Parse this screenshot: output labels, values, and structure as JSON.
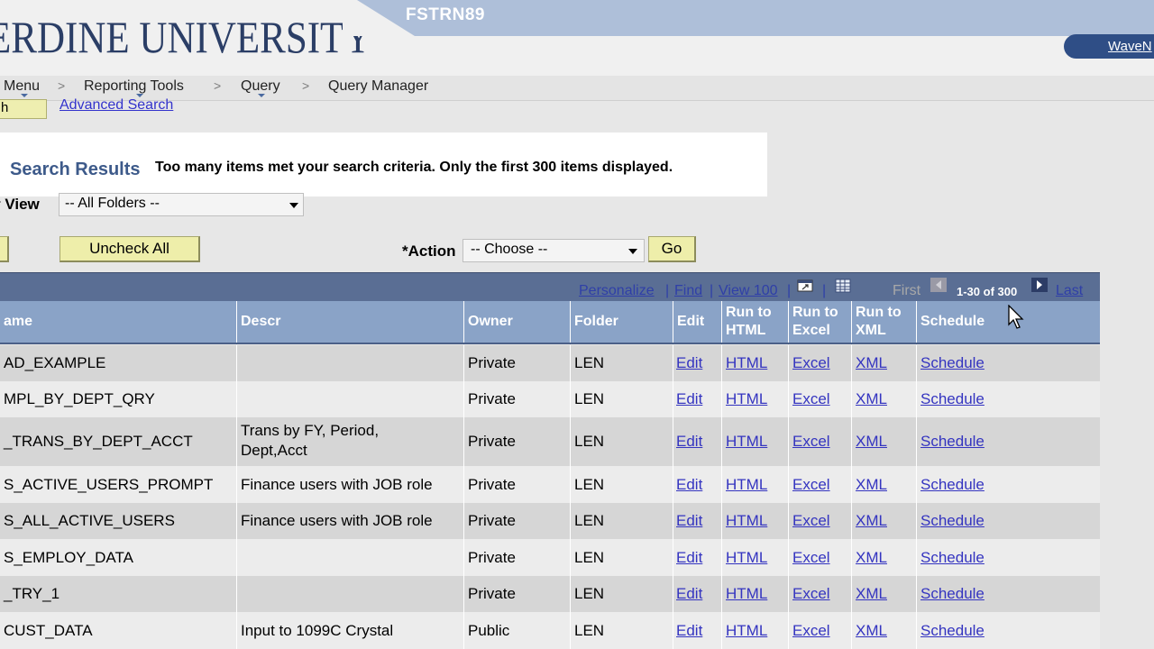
{
  "header": {
    "logo_text": "ERDINE UNIVERSITY",
    "database": "FSTRN89",
    "right_link": "WaveN"
  },
  "breadcrumb": {
    "items": [
      "Menu",
      "Reporting Tools",
      "Query",
      "Query Manager"
    ],
    "separator": ">"
  },
  "search": {
    "button_label": "h",
    "advanced_link": "Advanced Search"
  },
  "results": {
    "title": "Search Results",
    "message": "Too many items met your search criteria. Only the first 300 items displayed."
  },
  "folder_view": {
    "label": "r View",
    "selected": "-- All Folders --"
  },
  "actions": {
    "uncheck_all": "Uncheck All",
    "action_label": "*Action",
    "action_selected": "-- Choose --",
    "go_label": "Go"
  },
  "grid_nav": {
    "personalize": "Personalize",
    "find": "Find",
    "view100": "View 100",
    "sep": "|",
    "first": "First",
    "range": "1-30 of 300",
    "last": "Last"
  },
  "columns": {
    "name": "ame",
    "descr": "Descr",
    "owner": "Owner",
    "folder": "Folder",
    "edit": "Edit",
    "run_html_1": "Run to",
    "run_html_2": "HTML",
    "run_excel_1": "Run to",
    "run_excel_2": "Excel",
    "run_xml_1": "Run to",
    "run_xml_2": "XML",
    "schedule": "Schedule"
  },
  "link_labels": {
    "edit": "Edit",
    "html": "HTML",
    "excel": "Excel",
    "xml": "XML",
    "schedule": "Schedule"
  },
  "rows": [
    {
      "name": "AD_EXAMPLE",
      "descr1": "",
      "descr2": "",
      "owner": "Private",
      "folder": "LEN"
    },
    {
      "name": "MPL_BY_DEPT_QRY",
      "descr1": "",
      "descr2": "",
      "owner": "Private",
      "folder": "LEN"
    },
    {
      "name": "_TRANS_BY_DEPT_ACCT",
      "descr1": "Trans by FY, Period,",
      "descr2": "Dept,Acct",
      "owner": "Private",
      "folder": "LEN"
    },
    {
      "name": "S_ACTIVE_USERS_PROMPT",
      "descr1": "Finance users with JOB role",
      "descr2": "",
      "owner": "Private",
      "folder": "LEN"
    },
    {
      "name": "S_ALL_ACTIVE_USERS",
      "descr1": "Finance users with JOB role",
      "descr2": "",
      "owner": "Private",
      "folder": "LEN"
    },
    {
      "name": "S_EMPLOY_DATA",
      "descr1": "",
      "descr2": "",
      "owner": "Private",
      "folder": "LEN"
    },
    {
      "name": "_TRY_1",
      "descr1": "",
      "descr2": "",
      "owner": "Private",
      "folder": "LEN"
    },
    {
      "name": "CUST_DATA",
      "descr1": "Input to 1099C Crystal",
      "descr2": "",
      "owner": "Public",
      "folder": "LEN"
    }
  ]
}
